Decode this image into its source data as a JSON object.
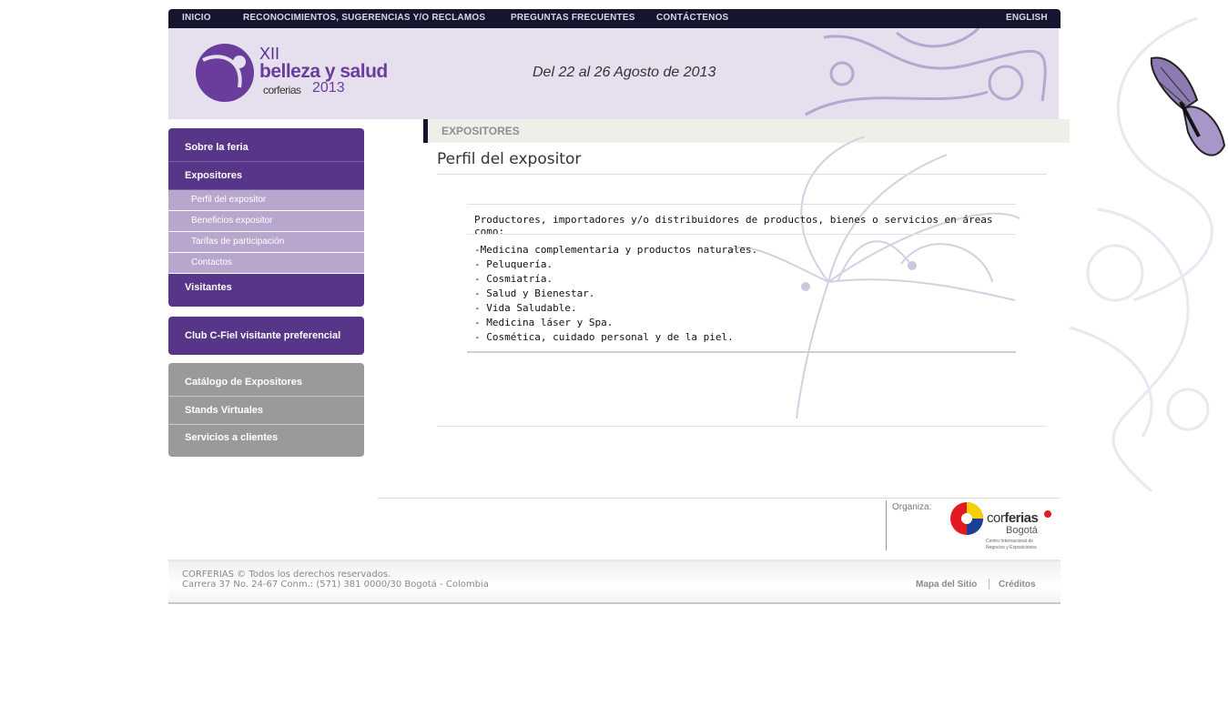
{
  "topnav": {
    "items": [
      "INICIO",
      "RECONOCIMIENTOS, SUGERENCIAS Y/O RECLAMOS",
      "PREGUNTAS FRECUENTES",
      "CONTÁCTENOS"
    ],
    "language": "ENGLISH"
  },
  "header": {
    "logo": {
      "edition": "XII",
      "title": "belleza y salud",
      "organizer": "corferias",
      "year": "2013"
    },
    "dates": "Del 22 al 26 Agosto de 2013"
  },
  "sidebar": {
    "group1": {
      "main": [
        "Sobre la feria",
        "Expositores"
      ],
      "sub": [
        "Perfil del expositor",
        "Beneficios expositor",
        "Tarifas de participación",
        "Contactos"
      ],
      "last": "Visitantes"
    },
    "club": "Club C-Fiel visitante preferencial",
    "group2": [
      "Catálogo de Expositores",
      "Stands Virtuales",
      "Servicios a clientes"
    ]
  },
  "main": {
    "section": "EXPOSITORES",
    "title": "Perfil del expositor",
    "intro": "Productores, importadores y/o distribuidores de productos, bienes o servicios en áreas como:",
    "areas": [
      "-Medicina complementaria y productos naturales.",
      "- Peluquería.",
      "- Cosmiatría.",
      "- Salud y Bienestar.",
      "- Vida Saludable.",
      "- Medicina láser y Spa.",
      "- Cosmética, cuidado personal y de la piel."
    ]
  },
  "organiza": {
    "label": "Organiza:",
    "brand_a": "cor",
    "brand_b": "ferias",
    "city": "Bogotá",
    "tagline_1": "Centro Internacional de",
    "tagline_2": "Negocios y Exposiciones"
  },
  "footer": {
    "copyright": "CORFERIAS © Todos los derechos reservados.",
    "address": "Carrera 37 No. 24-67 Conm.: (571) 381 0000/30 Bogotá - Colombia",
    "links": [
      "Mapa del Sitio",
      "Créditos"
    ]
  },
  "colors": {
    "nav_bg": "#15152f",
    "header_bg": "#e6e0ee",
    "menu_purple": "#573589",
    "menu_sub": "#b9a6cd",
    "menu_gray": "#9a9a9a"
  }
}
